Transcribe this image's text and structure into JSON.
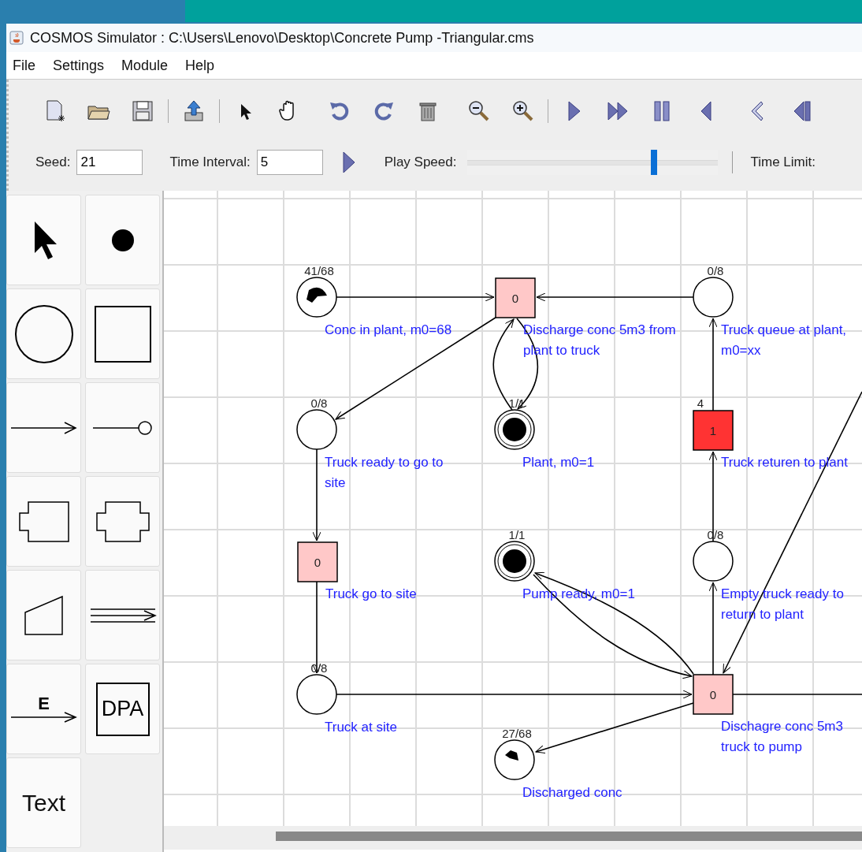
{
  "window": {
    "title": "COSMOS Simulator : C:\\Users\\Lenovo\\Desktop\\Concrete Pump -Triangular.cms"
  },
  "menu": [
    "File",
    "Settings",
    "Module",
    "Help"
  ],
  "controls": {
    "seed": {
      "label": "Seed:",
      "value": "21"
    },
    "time_interval": {
      "label": "Time Interval:",
      "value": "5"
    },
    "play_speed": {
      "label": "Play Speed:",
      "level": 0.745
    },
    "time_limit": {
      "label": "Time Limit:"
    }
  },
  "palette": [
    {
      "kind": "pointer"
    },
    {
      "kind": "token"
    },
    {
      "kind": "place"
    },
    {
      "kind": "transition"
    },
    {
      "kind": "arc"
    },
    {
      "kind": "inhibitor-arc"
    },
    {
      "kind": "macro-in"
    },
    {
      "kind": "macro-io"
    },
    {
      "kind": "trapezoid"
    },
    {
      "kind": "triple-arc"
    },
    {
      "kind": "event-arc",
      "label": "E"
    },
    {
      "kind": "dpa",
      "label": "DPA"
    },
    {
      "kind": "text",
      "label": "Text"
    }
  ],
  "places": [
    {
      "marking": "41/68",
      "kind": "partial",
      "label_lines": [
        "Conc in plant, m0=68"
      ]
    },
    {
      "marking": "0/8",
      "kind": "empty",
      "label_lines": [
        "Truck queue at plant,",
        "m0=xx"
      ]
    },
    {
      "marking": "0/8",
      "kind": "empty",
      "label_lines": [
        "Truck ready to go to",
        "site"
      ]
    },
    {
      "marking": "1/1",
      "kind": "full",
      "label_lines": [
        "Plant, m0=1"
      ]
    },
    {
      "marking": "1/1",
      "kind": "full",
      "label_lines": [
        "Pump ready, m0=1"
      ]
    },
    {
      "marking": "0/8",
      "kind": "empty",
      "label_lines": [
        "Empty truck ready to",
        "return to plant"
      ]
    },
    {
      "marking": "0/8",
      "kind": "empty",
      "label_lines": [
        "Truck at site"
      ]
    },
    {
      "marking": "27/68",
      "kind": "small",
      "label_lines": [
        "Discharged conc"
      ]
    }
  ],
  "transitions": [
    {
      "count": "0",
      "firing": false,
      "label_lines": [
        "Discharge conc 5m3 from",
        "plant to truck"
      ]
    },
    {
      "count": "1",
      "firing": true,
      "badge": "4",
      "label_lines": [
        "Truck returen to plant"
      ]
    },
    {
      "count": "0",
      "firing": false,
      "label_lines": [
        "Truck go to site"
      ]
    },
    {
      "count": "0",
      "firing": false,
      "label_lines": [
        "Dischagre conc 5m3",
        "truck to pump"
      ]
    }
  ]
}
